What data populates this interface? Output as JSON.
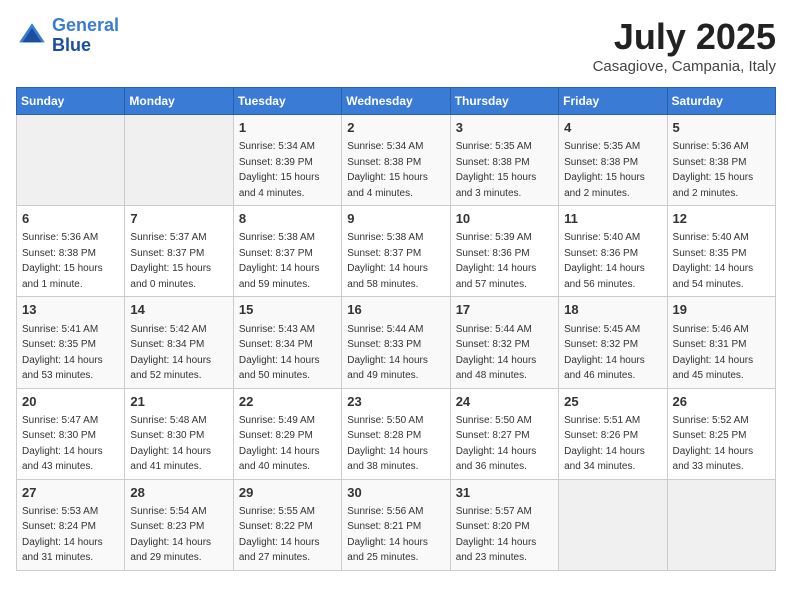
{
  "logo": {
    "line1": "General",
    "line2": "Blue"
  },
  "title": "July 2025",
  "location": "Casagiove, Campania, Italy",
  "weekdays": [
    "Sunday",
    "Monday",
    "Tuesday",
    "Wednesday",
    "Thursday",
    "Friday",
    "Saturday"
  ],
  "weeks": [
    [
      {
        "num": "",
        "sunrise": "",
        "sunset": "",
        "daylight": ""
      },
      {
        "num": "",
        "sunrise": "",
        "sunset": "",
        "daylight": ""
      },
      {
        "num": "1",
        "sunrise": "Sunrise: 5:34 AM",
        "sunset": "Sunset: 8:39 PM",
        "daylight": "Daylight: 15 hours and 4 minutes."
      },
      {
        "num": "2",
        "sunrise": "Sunrise: 5:34 AM",
        "sunset": "Sunset: 8:38 PM",
        "daylight": "Daylight: 15 hours and 4 minutes."
      },
      {
        "num": "3",
        "sunrise": "Sunrise: 5:35 AM",
        "sunset": "Sunset: 8:38 PM",
        "daylight": "Daylight: 15 hours and 3 minutes."
      },
      {
        "num": "4",
        "sunrise": "Sunrise: 5:35 AM",
        "sunset": "Sunset: 8:38 PM",
        "daylight": "Daylight: 15 hours and 2 minutes."
      },
      {
        "num": "5",
        "sunrise": "Sunrise: 5:36 AM",
        "sunset": "Sunset: 8:38 PM",
        "daylight": "Daylight: 15 hours and 2 minutes."
      }
    ],
    [
      {
        "num": "6",
        "sunrise": "Sunrise: 5:36 AM",
        "sunset": "Sunset: 8:38 PM",
        "daylight": "Daylight: 15 hours and 1 minute."
      },
      {
        "num": "7",
        "sunrise": "Sunrise: 5:37 AM",
        "sunset": "Sunset: 8:37 PM",
        "daylight": "Daylight: 15 hours and 0 minutes."
      },
      {
        "num": "8",
        "sunrise": "Sunrise: 5:38 AM",
        "sunset": "Sunset: 8:37 PM",
        "daylight": "Daylight: 14 hours and 59 minutes."
      },
      {
        "num": "9",
        "sunrise": "Sunrise: 5:38 AM",
        "sunset": "Sunset: 8:37 PM",
        "daylight": "Daylight: 14 hours and 58 minutes."
      },
      {
        "num": "10",
        "sunrise": "Sunrise: 5:39 AM",
        "sunset": "Sunset: 8:36 PM",
        "daylight": "Daylight: 14 hours and 57 minutes."
      },
      {
        "num": "11",
        "sunrise": "Sunrise: 5:40 AM",
        "sunset": "Sunset: 8:36 PM",
        "daylight": "Daylight: 14 hours and 56 minutes."
      },
      {
        "num": "12",
        "sunrise": "Sunrise: 5:40 AM",
        "sunset": "Sunset: 8:35 PM",
        "daylight": "Daylight: 14 hours and 54 minutes."
      }
    ],
    [
      {
        "num": "13",
        "sunrise": "Sunrise: 5:41 AM",
        "sunset": "Sunset: 8:35 PM",
        "daylight": "Daylight: 14 hours and 53 minutes."
      },
      {
        "num": "14",
        "sunrise": "Sunrise: 5:42 AM",
        "sunset": "Sunset: 8:34 PM",
        "daylight": "Daylight: 14 hours and 52 minutes."
      },
      {
        "num": "15",
        "sunrise": "Sunrise: 5:43 AM",
        "sunset": "Sunset: 8:34 PM",
        "daylight": "Daylight: 14 hours and 50 minutes."
      },
      {
        "num": "16",
        "sunrise": "Sunrise: 5:44 AM",
        "sunset": "Sunset: 8:33 PM",
        "daylight": "Daylight: 14 hours and 49 minutes."
      },
      {
        "num": "17",
        "sunrise": "Sunrise: 5:44 AM",
        "sunset": "Sunset: 8:32 PM",
        "daylight": "Daylight: 14 hours and 48 minutes."
      },
      {
        "num": "18",
        "sunrise": "Sunrise: 5:45 AM",
        "sunset": "Sunset: 8:32 PM",
        "daylight": "Daylight: 14 hours and 46 minutes."
      },
      {
        "num": "19",
        "sunrise": "Sunrise: 5:46 AM",
        "sunset": "Sunset: 8:31 PM",
        "daylight": "Daylight: 14 hours and 45 minutes."
      }
    ],
    [
      {
        "num": "20",
        "sunrise": "Sunrise: 5:47 AM",
        "sunset": "Sunset: 8:30 PM",
        "daylight": "Daylight: 14 hours and 43 minutes."
      },
      {
        "num": "21",
        "sunrise": "Sunrise: 5:48 AM",
        "sunset": "Sunset: 8:30 PM",
        "daylight": "Daylight: 14 hours and 41 minutes."
      },
      {
        "num": "22",
        "sunrise": "Sunrise: 5:49 AM",
        "sunset": "Sunset: 8:29 PM",
        "daylight": "Daylight: 14 hours and 40 minutes."
      },
      {
        "num": "23",
        "sunrise": "Sunrise: 5:50 AM",
        "sunset": "Sunset: 8:28 PM",
        "daylight": "Daylight: 14 hours and 38 minutes."
      },
      {
        "num": "24",
        "sunrise": "Sunrise: 5:50 AM",
        "sunset": "Sunset: 8:27 PM",
        "daylight": "Daylight: 14 hours and 36 minutes."
      },
      {
        "num": "25",
        "sunrise": "Sunrise: 5:51 AM",
        "sunset": "Sunset: 8:26 PM",
        "daylight": "Daylight: 14 hours and 34 minutes."
      },
      {
        "num": "26",
        "sunrise": "Sunrise: 5:52 AM",
        "sunset": "Sunset: 8:25 PM",
        "daylight": "Daylight: 14 hours and 33 minutes."
      }
    ],
    [
      {
        "num": "27",
        "sunrise": "Sunrise: 5:53 AM",
        "sunset": "Sunset: 8:24 PM",
        "daylight": "Daylight: 14 hours and 31 minutes."
      },
      {
        "num": "28",
        "sunrise": "Sunrise: 5:54 AM",
        "sunset": "Sunset: 8:23 PM",
        "daylight": "Daylight: 14 hours and 29 minutes."
      },
      {
        "num": "29",
        "sunrise": "Sunrise: 5:55 AM",
        "sunset": "Sunset: 8:22 PM",
        "daylight": "Daylight: 14 hours and 27 minutes."
      },
      {
        "num": "30",
        "sunrise": "Sunrise: 5:56 AM",
        "sunset": "Sunset: 8:21 PM",
        "daylight": "Daylight: 14 hours and 25 minutes."
      },
      {
        "num": "31",
        "sunrise": "Sunrise: 5:57 AM",
        "sunset": "Sunset: 8:20 PM",
        "daylight": "Daylight: 14 hours and 23 minutes."
      },
      {
        "num": "",
        "sunrise": "",
        "sunset": "",
        "daylight": ""
      },
      {
        "num": "",
        "sunrise": "",
        "sunset": "",
        "daylight": ""
      }
    ]
  ]
}
